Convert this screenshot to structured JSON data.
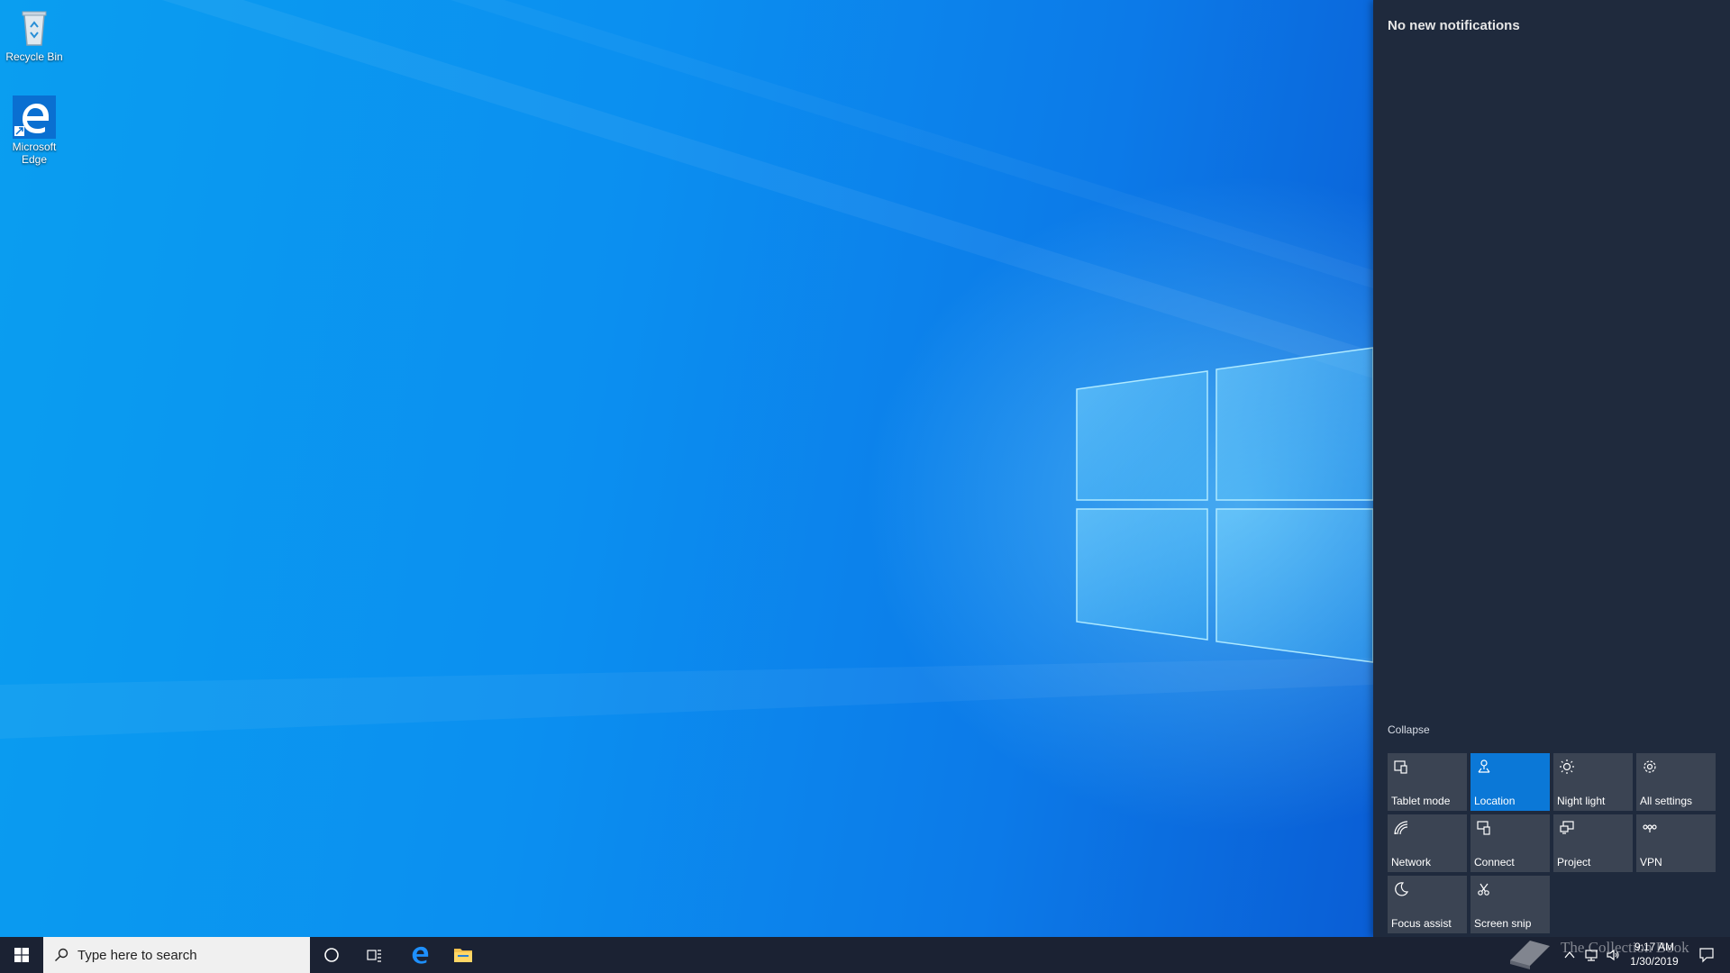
{
  "desktop": {
    "icons": [
      {
        "label": "Recycle Bin",
        "icon": "recycle-bin-icon"
      },
      {
        "label": "Microsoft Edge",
        "icon": "edge-icon"
      }
    ]
  },
  "action_center": {
    "empty_text": "No new notifications",
    "collapse_label": "Collapse",
    "tiles": [
      {
        "label": "Tablet mode",
        "icon": "tablet-mode-icon",
        "active": false
      },
      {
        "label": "Location",
        "icon": "location-icon",
        "active": true
      },
      {
        "label": "Night light",
        "icon": "night-light-icon",
        "active": false
      },
      {
        "label": "All settings",
        "icon": "gear-icon",
        "active": false
      },
      {
        "label": "Network",
        "icon": "network-icon",
        "active": false
      },
      {
        "label": "Connect",
        "icon": "connect-icon",
        "active": false
      },
      {
        "label": "Project",
        "icon": "project-icon",
        "active": false
      },
      {
        "label": "VPN",
        "icon": "vpn-icon",
        "active": false
      },
      {
        "label": "Focus assist",
        "icon": "moon-icon",
        "active": false
      },
      {
        "label": "Screen snip",
        "icon": "screen-snip-icon",
        "active": false
      }
    ]
  },
  "taskbar": {
    "search_placeholder": "Type here to search",
    "pinned": [
      "cortana-icon",
      "task-view-icon",
      "edge-icon",
      "file-explorer-icon"
    ],
    "tray": [
      "chevron-up-icon",
      "network-icon",
      "volume-icon"
    ],
    "time": "9:17 AM",
    "date": "1/30/2019",
    "notification_icon": "notification-icon"
  },
  "watermark": {
    "text": "The Collection Book"
  },
  "colors": {
    "accent": "#0b78d7",
    "action_center_bg": "#1f2a3d",
    "tile_bg": "#3b4453",
    "taskbar_bg": "#1b2233"
  }
}
